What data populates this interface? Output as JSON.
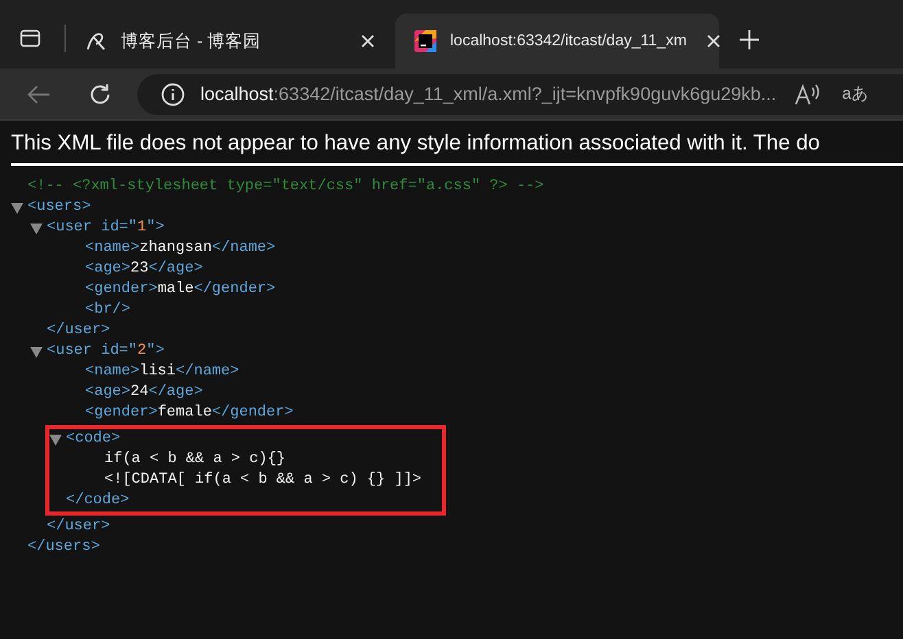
{
  "tabs": [
    {
      "title": "博客后台 - 博客园",
      "selected": false
    },
    {
      "title": "localhost:63342/itcast/day_11_xm",
      "selected": true
    }
  ],
  "address_bar": {
    "host": "localhost",
    "path": ":63342/itcast/day_11_xml/a.xml?_ijt=knvpfk90guvk6gu29kb...",
    "translate_glyph": "aあ"
  },
  "banner": "This XML file does not appear to have any style information associated with it. The do",
  "xml_tree": [
    {
      "kind": "comment",
      "text": "<!-- <?xml-stylesheet type=\"text/css\" href=\"a.css\" ?> -->"
    },
    {
      "kind": "element",
      "open": "<users>",
      "close": "</users>",
      "expanded": true,
      "highlighted": false,
      "children": [
        {
          "kind": "element",
          "open": "<user id=\"",
          "attr_value": "1",
          "open_end": "\">",
          "close": "</user>",
          "expanded": true,
          "highlighted": false,
          "children": [
            {
              "kind": "leaf",
              "open": "<name>",
              "text": "zhangsan",
              "close": "</name>"
            },
            {
              "kind": "leaf",
              "open": "<age>",
              "text": "23",
              "close": "</age>"
            },
            {
              "kind": "leaf",
              "open": "<gender>",
              "text": "male",
              "close": "</gender>"
            },
            {
              "kind": "empty",
              "open": "<br/>"
            }
          ]
        },
        {
          "kind": "element",
          "open": "<user id=\"",
          "attr_value": "2",
          "open_end": "\">",
          "close": "</user>",
          "expanded": true,
          "highlighted": false,
          "children": [
            {
              "kind": "leaf",
              "open": "<name>",
              "text": "lisi",
              "close": "</name>"
            },
            {
              "kind": "leaf",
              "open": "<age>",
              "text": "24",
              "close": "</age>"
            },
            {
              "kind": "leaf",
              "open": "<gender>",
              "text": "female",
              "close": "</gender>"
            },
            {
              "kind": "element",
              "open": "<code>",
              "close": "</code>",
              "expanded": true,
              "highlighted": true,
              "children": [
                {
                  "kind": "text",
                  "text": "if(a < b && a > c){}"
                },
                {
                  "kind": "text",
                  "text": "<![CDATA[ if(a < b && a > c) {} ]]>"
                }
              ]
            }
          ]
        }
      ]
    }
  ]
}
